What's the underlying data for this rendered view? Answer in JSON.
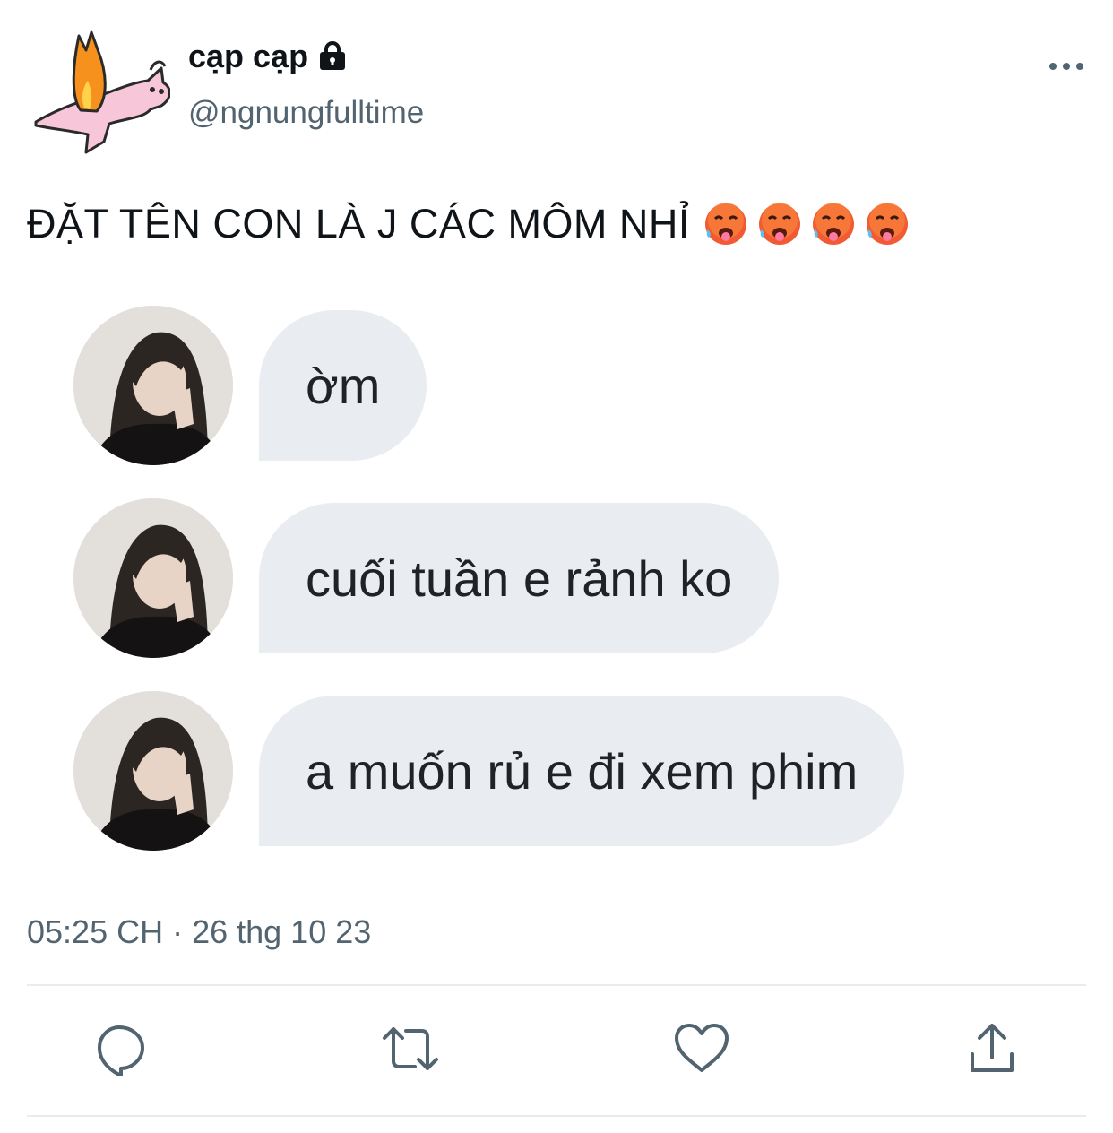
{
  "user": {
    "display_name": "cạp cạp",
    "handle": "@ngnungfulltime",
    "avatar": "pink-rabbit-flame-icon"
  },
  "tweet": {
    "text": "ĐẶT TÊN CON LÀ J CÁC MÔM NHỈ",
    "emojis": [
      "hot-face-emoji",
      "hot-face-emoji",
      "hot-face-emoji",
      "hot-face-emoji"
    ],
    "timestamp": "05:25 CH · 26 thg 10 23"
  },
  "chat": {
    "messages": [
      {
        "text": "ờm"
      },
      {
        "text": "cuối tuần e rảnh ko"
      },
      {
        "text": "a muốn rủ e đi xem phim"
      }
    ]
  },
  "actions": {
    "reply": "reply-icon",
    "retweet": "retweet-icon",
    "like": "heart-icon",
    "share": "share-icon"
  },
  "colors": {
    "text": "#0f1419",
    "secondary": "#536471",
    "bubble": "#e9edf2",
    "divider": "#e6ecf0"
  }
}
